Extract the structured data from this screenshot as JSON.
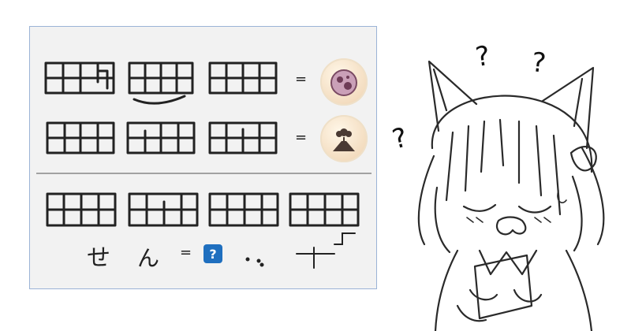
{
  "puzzle": {
    "row1": {
      "equals": "=",
      "icon": "planet-coin-icon"
    },
    "row2": {
      "equals": "=",
      "icon": "volcano-coin-icon"
    },
    "answer": {
      "kana_1": "せ",
      "kana_2": "ん",
      "equals": "=",
      "question": "?"
    }
  },
  "character": {
    "icon": "confused-cat-girl-icon",
    "mark_1": "?",
    "mark_2": "?",
    "mark_3": "?"
  },
  "colors": {
    "badge": "#1f6fbf",
    "paper_border": "#9bb3d6",
    "ink": "#222222"
  }
}
